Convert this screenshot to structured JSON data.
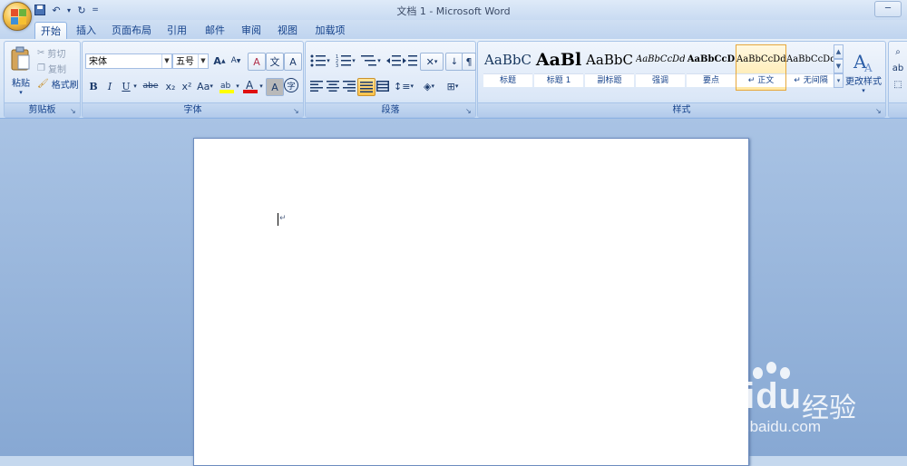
{
  "window": {
    "title": "文档 1 - Microsoft Word"
  },
  "qat": {
    "undo_arrow": "▾",
    "customize": "="
  },
  "tabs": [
    "开始",
    "插入",
    "页面布局",
    "引用",
    "邮件",
    "审阅",
    "视图",
    "加载项"
  ],
  "clipboard": {
    "paste_label": "粘贴",
    "cut_label": "剪切",
    "copy_label": "复制",
    "format_painter_label": "格式刷",
    "group_label": "剪贴板"
  },
  "font": {
    "font_name": "宋体",
    "font_size": "五号",
    "group_label": "字体",
    "bold": "B",
    "italic": "I",
    "underline": "U",
    "strike": "abe",
    "subscript": "x₂",
    "superscript": "x²",
    "change_case": "Aa",
    "grow": "A",
    "shrink": "A",
    "clear_format": "A",
    "phonetic": "文",
    "char_border": "A",
    "char_shading": "A",
    "enclose": "字"
  },
  "paragraph": {
    "group_label": "段落"
  },
  "styles": {
    "group_label": "样式",
    "items": [
      {
        "preview": "AaBbC",
        "name": "标题"
      },
      {
        "preview": "AaBl",
        "name": "标题 1"
      },
      {
        "preview": "AaBbC",
        "name": "副标题"
      },
      {
        "preview": "AaBbCcDd",
        "name": "强调"
      },
      {
        "preview": "AaBbCcD",
        "name": "要点"
      },
      {
        "preview": "AaBbCcDd",
        "name": "↵ 正文"
      },
      {
        "preview": "AaBbCcDd",
        "name": "↵ 无间隔"
      }
    ],
    "change_styles_label": "更改样式"
  },
  "watermark": {
    "logo": "Bai",
    "logo2": "du",
    "sub": "经验",
    "url": "jingyan.baidu.com"
  }
}
